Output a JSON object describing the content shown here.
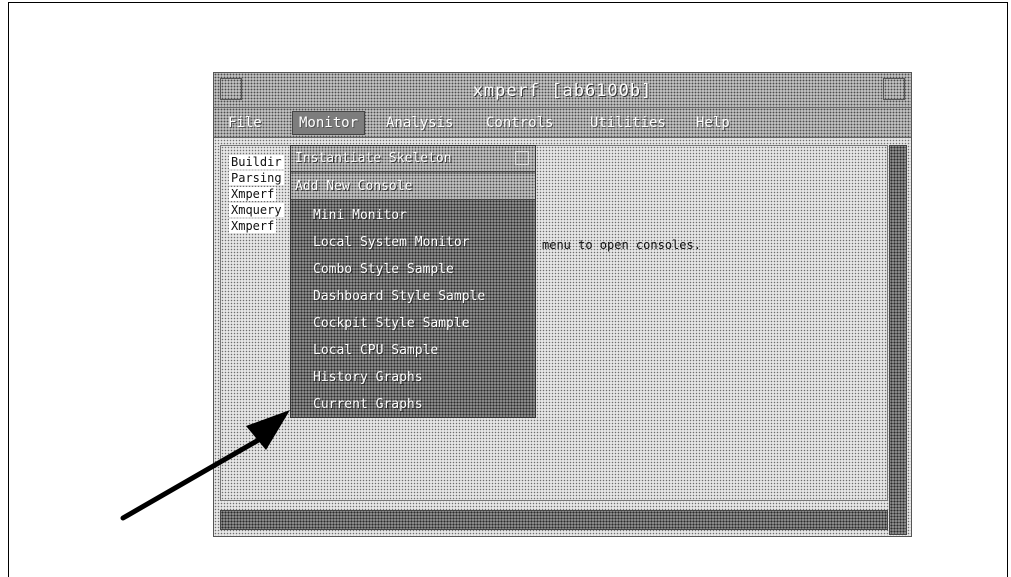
{
  "window": {
    "title": "xmperf [ab6100b]"
  },
  "menubar": {
    "items": [
      "File",
      "Monitor",
      "Analysis",
      "Controls",
      "Utilities",
      "Help"
    ]
  },
  "log": {
    "lines": [
      "Buildir",
      "Parsing",
      "Xmperf",
      "Xmquery",
      "Xmperf"
    ],
    "line5_tail": "menu to open consoles."
  },
  "monitor_menu": {
    "header_items": [
      "Instantiate Skeleton",
      "Add New Console"
    ],
    "items": [
      "Mini Monitor",
      "Local System Monitor",
      "Combo Style Sample",
      "Dashboard Style Sample",
      "Cockpit Style Sample",
      "Local CPU Sample",
      "History Graphs",
      "Current Graphs"
    ]
  }
}
